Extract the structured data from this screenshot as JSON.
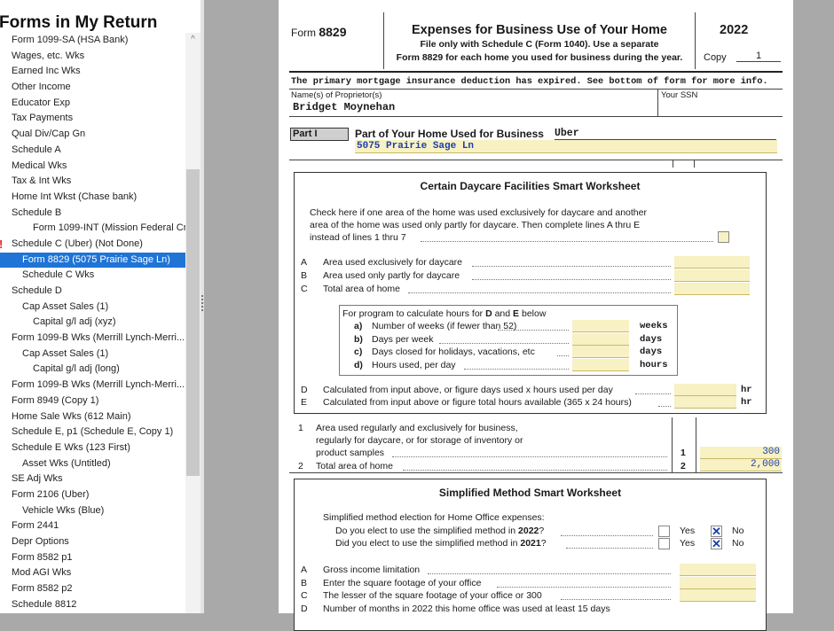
{
  "sidebar": {
    "title": "Forms in My Return",
    "items": [
      {
        "label": "Form 1099-SA (HSA Bank)",
        "indent": 0
      },
      {
        "label": "Wages, etc. Wks",
        "indent": 0
      },
      {
        "label": "Earned Inc Wks",
        "indent": 0
      },
      {
        "label": "Other Income",
        "indent": 0
      },
      {
        "label": "Educator Exp",
        "indent": 0
      },
      {
        "label": "Tax Payments",
        "indent": 0
      },
      {
        "label": "Qual Div/Cap Gn",
        "indent": 0
      },
      {
        "label": "Schedule A",
        "indent": 0
      },
      {
        "label": "Medical Wks",
        "indent": 0
      },
      {
        "label": "Tax & Int Wks",
        "indent": 0
      },
      {
        "label": "Home Int Wkst (Chase bank)",
        "indent": 0
      },
      {
        "label": "Schedule B",
        "indent": 0
      },
      {
        "label": "Form 1099-INT (Mission Federal Cr...",
        "indent": 2
      },
      {
        "label": "Schedule C (Uber) (Not Done)",
        "indent": 0,
        "error": true
      },
      {
        "label": "Form 8829 (5075 Prairie Sage Ln)",
        "indent": 1,
        "selected": true
      },
      {
        "label": "Schedule C Wks",
        "indent": 1
      },
      {
        "label": "Schedule D",
        "indent": 0
      },
      {
        "label": "Cap Asset Sales (1)",
        "indent": 1
      },
      {
        "label": "Capital g/l adj (xyz)",
        "indent": 2
      },
      {
        "label": "Form 1099-B Wks (Merrill Lynch-Merri...",
        "indent": 0
      },
      {
        "label": "Cap Asset Sales (1)",
        "indent": 1
      },
      {
        "label": "Capital g/l adj (long)",
        "indent": 2
      },
      {
        "label": "Form 1099-B Wks (Merrill Lynch-Merri...",
        "indent": 0
      },
      {
        "label": "Form 8949 (Copy 1)",
        "indent": 0
      },
      {
        "label": "Home Sale Wks (612 Main)",
        "indent": 0
      },
      {
        "label": "Schedule E, p1 (Schedule E, Copy 1)",
        "indent": 0
      },
      {
        "label": "Schedule E Wks (123 First)",
        "indent": 0
      },
      {
        "label": "Asset Wks (Untitled)",
        "indent": 1
      },
      {
        "label": "SE Adj Wks",
        "indent": 0
      },
      {
        "label": "Form 2106 (Uber)",
        "indent": 0
      },
      {
        "label": "Vehicle Wks (Blue)",
        "indent": 1
      },
      {
        "label": "Form 2441",
        "indent": 0
      },
      {
        "label": "Depr Options",
        "indent": 0
      },
      {
        "label": "Form 8582 p1",
        "indent": 0
      },
      {
        "label": "Mod AGI Wks",
        "indent": 0
      },
      {
        "label": "Form 8582 p2",
        "indent": 0
      },
      {
        "label": "Schedule 8812",
        "indent": 0
      }
    ],
    "error_mark": "!",
    "scroll_up_glyph": "^"
  },
  "form": {
    "form_label": "Form",
    "form_number": "8829",
    "title": "Expenses for Business Use of Your Home",
    "subtitle1": "File only with Schedule C (Form 1040). Use a separate",
    "subtitle2": "Form 8829 for each home you used for business during the year.",
    "year": "2022",
    "copy_label": "Copy",
    "copy_value": "1",
    "notice": "The primary mortgage insurance deduction has expired. See bottom of form for more info.",
    "proprietor_label": "Name(s) of Proprietor(s)",
    "proprietor_value": "Bridget Moynehan",
    "ssn_label": "Your SSN",
    "part_label": "Part I",
    "part_title": "Part of Your Home Used for Business",
    "business_name": "Uber",
    "address": "5075 Prairie Sage Ln",
    "daycare": {
      "title": "Certain Daycare Facilities Smart Worksheet",
      "check_text": [
        "Check here if one area of the home was used exclusively for daycare and another",
        "area of the home was used only partly for daycare. Then complete lines A thru E",
        "instead of lines 1 thru 7"
      ],
      "lines": [
        {
          "letter": "A",
          "label": "Area used exclusively for daycare"
        },
        {
          "letter": "B",
          "label": "Area used only partly for daycare"
        },
        {
          "letter": "C",
          "label": "Total area of home"
        }
      ],
      "program_heading": "For program to calculate hours for",
      "program_d": "D",
      "program_and": "and",
      "program_e": "E",
      "program_below": "below",
      "program_lines": [
        {
          "letter": "a)",
          "label": "Number of weeks (if fewer than 52)",
          "unit": "weeks"
        },
        {
          "letter": "b)",
          "label": "Days per week",
          "unit": "days"
        },
        {
          "letter": "c)",
          "label": "Days closed for holidays, vacations, etc",
          "unit": "days"
        },
        {
          "letter": "d)",
          "label": "Hours used, per day",
          "unit": "hours"
        }
      ],
      "calc_lines": [
        {
          "letter": "D",
          "label": "Calculated from input above, or figure days used x hours used per day",
          "unit": "hr"
        },
        {
          "letter": "E",
          "label": "Calculated from input above or figure total hours available (365 x 24 hours)",
          "unit": "hr"
        }
      ]
    },
    "line1": {
      "num": "1",
      "text": [
        "Area used regularly and exclusively for business,",
        "regularly for daycare, or for storage of inventory or",
        "product samples"
      ],
      "box": "1",
      "value": "300"
    },
    "line2": {
      "num": "2",
      "text": "Total area of home",
      "box": "2",
      "value": "2,000"
    },
    "simplified": {
      "title": "Simplified Method Smart Worksheet",
      "election_label": "Simplified method election for Home Office expenses:",
      "q1_prefix": "Do you elect to use the simplified method in ",
      "q1_year": "2022",
      "q2_prefix": "Did you elect to use the simplified method in ",
      "q2_year": "2021",
      "yes_label": "Yes",
      "no_label": "No",
      "x_mark": "✕",
      "lines": [
        {
          "letter": "A",
          "label": "Gross income limitation"
        },
        {
          "letter": "B",
          "label": "Enter the square footage of your office"
        },
        {
          "letter": "C",
          "label": "The lesser of the square footage of your office or 300"
        },
        {
          "letter": "D",
          "label": "Number of months in 2022 this home office was used at least 15 days"
        }
      ]
    }
  }
}
